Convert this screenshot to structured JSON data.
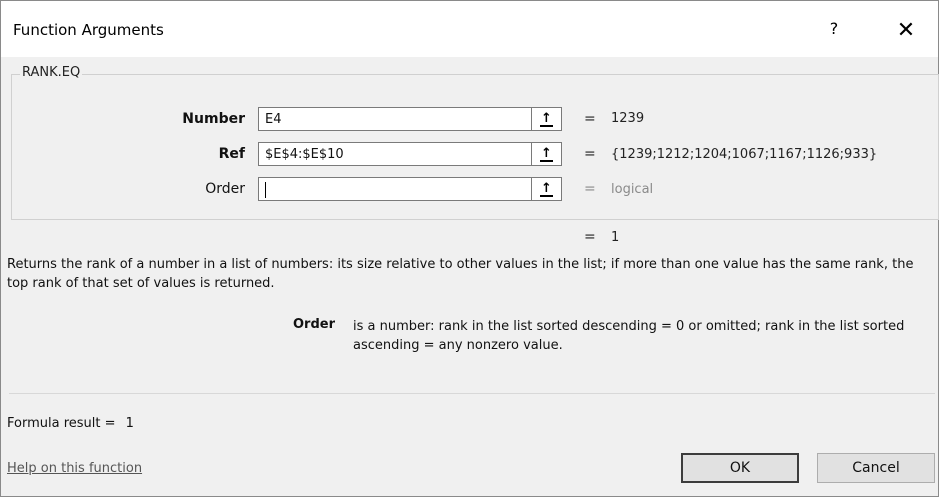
{
  "dialog": {
    "title": "Function Arguments",
    "help_symbol": "?",
    "close_symbol": "✕"
  },
  "function": {
    "name": "RANK.EQ",
    "args": [
      {
        "label": "Number",
        "bold": true,
        "value": "E4",
        "equals": "=",
        "result": "1239",
        "result_is_hint": false
      },
      {
        "label": "Ref",
        "bold": true,
        "value": "$E$4:$E$10",
        "equals": "=",
        "result": "{1239;1212;1204;1067;1167;1126;933}",
        "result_is_hint": false
      },
      {
        "label": "Order",
        "bold": false,
        "value": "",
        "equals": "=",
        "result": "logical",
        "result_is_hint": true
      }
    ],
    "collapse_icon": "collapse-dialog-icon",
    "overall_equals": "=",
    "overall_result": "1",
    "description": "Returns the rank of a number in a list of numbers: its size relative to other values in the list; if more than one value has the same rank, the top rank of that set of values is returned.",
    "current_param_name": "Order",
    "current_param_description": "is a number: rank in the list sorted descending = 0 or omitted; rank in the list sorted ascending = any nonzero value."
  },
  "footer": {
    "formula_result_label": "Formula result =",
    "formula_result_value": "1",
    "help_link": "Help on this function",
    "ok_label": "OK",
    "cancel_label": "Cancel"
  }
}
